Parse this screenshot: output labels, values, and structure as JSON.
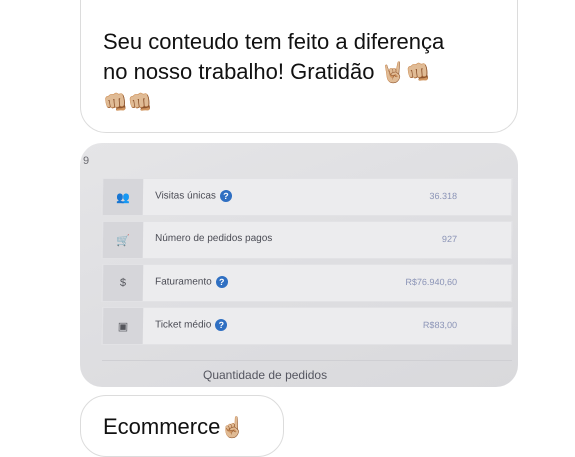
{
  "messages": {
    "top": {
      "line1": "Seu conteudo tem feito a diferença",
      "line2": "no nosso trabalho! Gratidão",
      "line2_emojis": "🤘🏼👊🏼",
      "line3_emojis": "👊🏼👊🏼"
    },
    "bottom": {
      "text": "Ecommerce",
      "emoji": "☝🏼"
    }
  },
  "photo": {
    "corner_mark": "9",
    "stats": [
      {
        "icon": "users-icon",
        "glyph": "👥",
        "label": "Visitas únicas",
        "has_help": true,
        "value": "36.318"
      },
      {
        "icon": "cart-icon",
        "glyph": "🛒",
        "label": "Número de pedidos pagos",
        "has_help": false,
        "value": "927"
      },
      {
        "icon": "dollar-icon",
        "glyph": "$",
        "label": "Faturamento",
        "has_help": true,
        "value": "R$76.940,60"
      },
      {
        "icon": "ticket-icon",
        "glyph": "▣",
        "label": "Ticket médio",
        "has_help": true,
        "value": "R$83,00"
      }
    ],
    "help_glyph": "?",
    "footer_label": "Quantidade de pedidos"
  }
}
